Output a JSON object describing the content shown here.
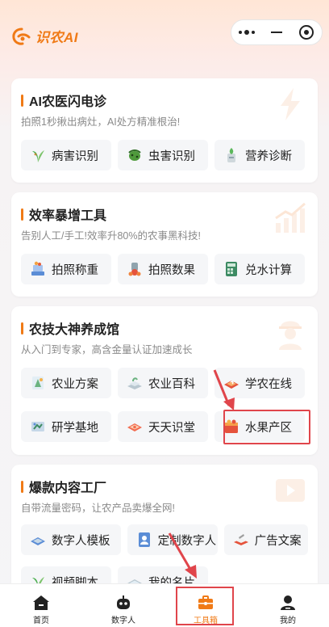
{
  "app": {
    "brand": "识农AI"
  },
  "capsule": {
    "more_icon": "more-dots-icon",
    "minimize_icon": "minus-icon",
    "close_icon": "target-icon"
  },
  "colors": {
    "accent": "#f07a16",
    "highlight": "#e0454b"
  },
  "sections": [
    {
      "title": "AI农医闪电诊",
      "subtitle": "拍照1秒揪出病灶，AI处方精准根治!",
      "deco_icon": "lightning-icon",
      "items": [
        {
          "label": "病害识别",
          "icon": "leaf-disease-icon"
        },
        {
          "label": "虫害识别",
          "icon": "bug-icon"
        },
        {
          "label": "营养诊断",
          "icon": "nutrition-icon"
        }
      ]
    },
    {
      "title": "效率暴增工具",
      "subtitle": "告别人工/手工!效率升80%的农事黑科技!",
      "deco_icon": "growth-chart-icon",
      "items": [
        {
          "label": "拍照称重",
          "icon": "scale-icon"
        },
        {
          "label": "拍照数果",
          "icon": "fruit-count-icon"
        },
        {
          "label": "兑水计算",
          "icon": "calculator-icon"
        }
      ]
    },
    {
      "title": "农技大神养成馆",
      "subtitle": "从入门到专家，高含金量认证加速成长",
      "deco_icon": "worker-icon",
      "items": [
        {
          "label": "农业方案",
          "icon": "plan-icon"
        },
        {
          "label": "农业百科",
          "icon": "encyclopedia-icon"
        },
        {
          "label": "学农在线",
          "icon": "online-learning-icon"
        },
        {
          "label": "研学基地",
          "icon": "study-base-icon"
        },
        {
          "label": "天天识堂",
          "icon": "daily-class-icon"
        },
        {
          "label": "水果产区",
          "icon": "fruit-region-icon"
        }
      ]
    },
    {
      "title": "爆款内容工厂",
      "subtitle": "自带流量密码，让农产品卖爆全网!",
      "deco_icon": "video-play-icon",
      "items": [
        {
          "label": "数字人模板",
          "icon": "template-icon"
        },
        {
          "label": "定制数字人",
          "icon": "custom-avatar-icon"
        },
        {
          "label": "广告文案",
          "icon": "ad-copy-icon"
        },
        {
          "label": "视频脚本",
          "icon": "video-script-icon"
        },
        {
          "label": "我的名片",
          "icon": "business-card-icon"
        }
      ]
    }
  ],
  "tabbar": [
    {
      "label": "首页",
      "icon": "home-icon",
      "active": false
    },
    {
      "label": "数字人",
      "icon": "robot-icon",
      "active": false
    },
    {
      "label": "工具箱",
      "icon": "toolbox-icon",
      "active": true
    },
    {
      "label": "我的",
      "icon": "profile-icon",
      "active": false
    }
  ]
}
